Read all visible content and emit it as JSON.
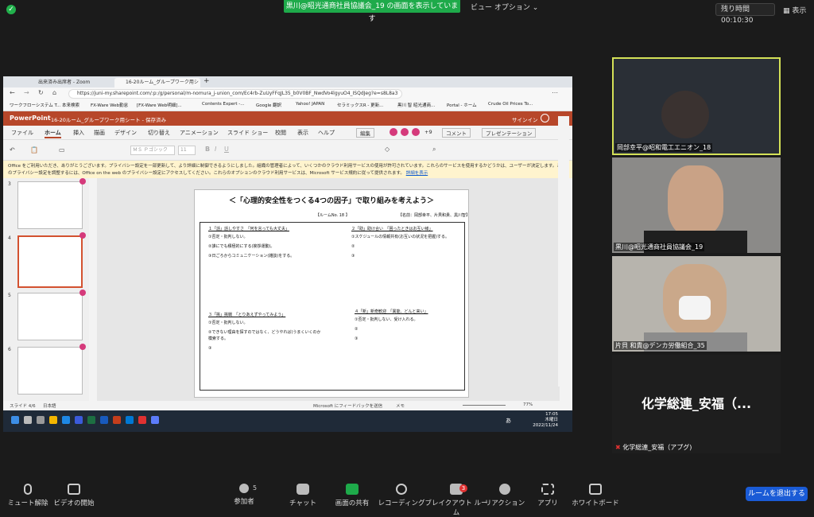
{
  "topbar": {
    "share_banner": "黒川@昭光通商社員協議会_19 の画面を表示しています",
    "view_options": "ビュー オプション ⌄",
    "remaining_label": "残り時間",
    "remaining_time": "00:10:30",
    "display": "表示"
  },
  "browser": {
    "tabs": [
      "出来済み出席者 - Zoom",
      "16-20ルーム_グループワーク用シート"
    ],
    "url": "https://juni-my.sharepoint.com/:p:/g/personal/m-nomura_j-union_com/Ec4rb-ZuUyFFqJL35_b0V0BF_NwdVo4lgyuO4_ISQdJeg?e=s8L8a3",
    "bookmarks": [
      "ワークフローシステム T...",
      "本来検索",
      "FX-Ware Web勤怠",
      "[FX-Ware Web明細]...",
      "Contents Expert -...",
      "Google 翻訳",
      "Yahoo! JAPAN",
      "セラミックスR - 更新...",
      "黒川 智 昭光通商...",
      "Portal - ホーム",
      "Crude Oil Prices To..."
    ]
  },
  "ppt": {
    "app": "PowerPoint",
    "doc_title": "16-20ルーム_グループワーク用シート - 保存済み",
    "signin": "サインイン",
    "menu": [
      "ファイル",
      "ホーム",
      "挿入",
      "描画",
      "デザイン",
      "切り替え",
      "アニメーション",
      "スライド ショー",
      "校閲",
      "表示",
      "ヘルプ"
    ],
    "edit_btn": "編集",
    "count": "+9",
    "comment_btn": "コメント",
    "present_btn": "プレゼンテーション",
    "font": "ＭＳ Ｐゴシック",
    "font_size": "11",
    "notice": "Office をご利用いただき、ありがとうございます。プライバシー設定を一部更新して、より詳細に制御できるようにしました。組織の管理者によって、いくつかのクラウド利用サービスの使用が許可されています。これらのサービスを使用するかどうかは、ユーザーが決定します。これらのプライバシー設定を調整するには、Office on the web のプライバシー設定にアクセスしてください。これらのオプションのクラウド利用サービスは、Microsoft サービス規約に従って提供されます。",
    "notice_link": "詳細を表示",
    "slide_numbers": [
      "3",
      "4",
      "5",
      "6"
    ],
    "status_left": "スライド 4/6",
    "status_lang": "日本語",
    "status_feedback": "Microsoft にフィードバックを送信",
    "status_memo": "メモ",
    "zoom": "77%",
    "clock_time": "17:05",
    "clock_day": "木曜日",
    "clock_date": "2022/11/24",
    "ime": "あ"
  },
  "slide": {
    "title": "＜「心理的安全性をつくる4つの因子」で取り組みを考えよう＞",
    "room": "【ルームNo. 18 】",
    "names": "【名前：岡部幸平、片貝和貴、黒川智】",
    "q1_title": "１「話」話しやすさ　「何を言っても大丈夫」",
    "q1_lines": [
      "①否定・批判しない。",
      "②誰にでも積極的にする(挨拶運動)。",
      "③日ごろからコミュニケーション(雑談)をする。"
    ],
    "q2_title": "２「助」助け合い　「困ったときはお互い様」",
    "q2_lines": [
      "①スケジュールの情報共有(お互いの状況を把握)する。",
      "②",
      "③"
    ],
    "q3_title": "３「挑」挑戦　「とりあえずやってみよう」",
    "q3_lines": [
      "①否定・批判しない。",
      "②できない理由を探すのではなく、どうやれば(うまくいくのか",
      "模索する。",
      "③"
    ],
    "q4_title": "４「新」新奇歓迎　「異能、どんと来い」",
    "q4_lines": [
      "①否定・批判しない、受け入れる。",
      "②",
      "③"
    ]
  },
  "participants": [
    {
      "name": "岡部幸平@昭和電工エニオン_18"
    },
    {
      "name": "黒川@昭光通商社員協議会_19"
    },
    {
      "name": "片貝 和貴@デンカ労働組合_35"
    },
    {
      "name": "化学総連_安福（アプグ)",
      "big": "化学総連_安福（..."
    }
  ],
  "controls": {
    "mute": "ミュート解除",
    "video": "ビデオの開始",
    "participants": "参加者",
    "participants_count": "5",
    "chat": "チャット",
    "share": "画面の共有",
    "record": "レコーディング",
    "breakout": "ブレイクアウト ルーム",
    "breakout_count": "3",
    "reactions": "リアクション",
    "apps": "アプリ",
    "whiteboard": "ホワイトボード",
    "leave": "ルームを退出する"
  },
  "colors": {
    "ppt": "#b7472a",
    "share": "#1eaa4a",
    "leave": "#1a5bd6",
    "speaker": "#d4e157"
  }
}
